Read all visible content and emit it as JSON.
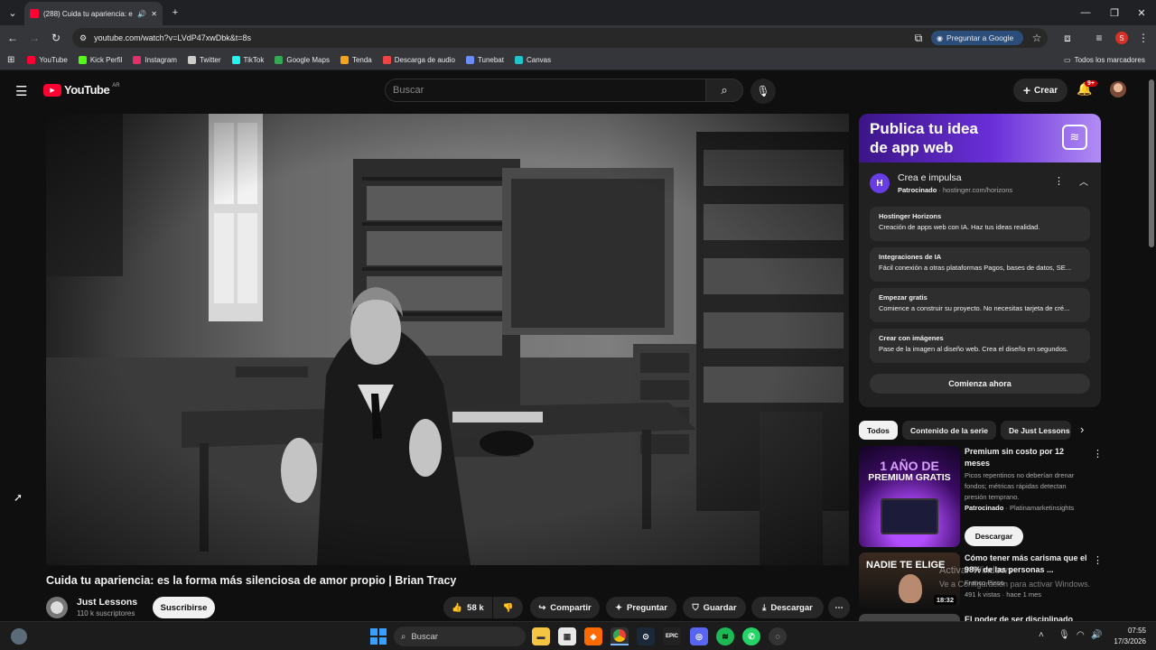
{
  "browser": {
    "tab_title": "(288) Cuida tu apariencia: e",
    "url": "youtube.com/watch?v=LVdP47xwDbk&t=8s",
    "google_button": "Preguntar a Google",
    "profile_initial": "S",
    "bookmarks": [
      {
        "label": "YouTube",
        "color": "#ff0033"
      },
      {
        "label": "Kick Perfil",
        "color": "#53fc18"
      },
      {
        "label": "Instagram",
        "color": "#e1306c"
      },
      {
        "label": "Twitter",
        "color": "#cccccc"
      },
      {
        "label": "TikTok",
        "color": "#25f4ee"
      },
      {
        "label": "Google Maps",
        "color": "#34a853"
      },
      {
        "label": "Tenda",
        "color": "#f7a21b"
      },
      {
        "label": "Descarga de audio",
        "color": "#ef4444"
      },
      {
        "label": "Tunebat",
        "color": "#6c8cff"
      },
      {
        "label": "Canvas",
        "color": "#20c4cb"
      }
    ],
    "all_bookmarks": "Todos los marcadores"
  },
  "youtube": {
    "logo": "YouTube",
    "region": "AR",
    "search_placeholder": "Buscar",
    "create_label": "Crear",
    "notifications": "9+",
    "video": {
      "title": "Cuida tu apariencia: es la forma más silenciosa de amor propio | Brian Tracy",
      "channel": "Just Lessons",
      "subscribers": "110 k suscriptores",
      "subscribe": "Suscribirse",
      "likes": "58 k",
      "share": "Compartir",
      "ask": "Preguntar",
      "save": "Guardar",
      "download": "Descargar"
    },
    "ad": {
      "banner_line1": "Publica tu idea",
      "banner_line2": "de app web",
      "title": "Crea e impulsa",
      "sponsored": "Patrocinado",
      "domain": "hostinger.com/horizons",
      "features": [
        {
          "title": "Hostinger Horizons",
          "desc": "Creación de apps web con IA. Haz tus ideas realidad."
        },
        {
          "title": "Integraciones de IA",
          "desc": "Fácil conexión a otras plataformas Pagos, bases de datos, SE..."
        },
        {
          "title": "Empezar gratis",
          "desc": "Comience a construir su proyecto. No necesitas tarjeta de cré..."
        },
        {
          "title": "Crear con imágenes",
          "desc": "Pase de la imagen al diseño web. Crea el diseño en segundos."
        }
      ],
      "cta": "Comienza ahora"
    },
    "chips": [
      "Todos",
      "Contenido de la serie",
      "De Just Lessons"
    ],
    "recommendations": [
      {
        "thumb_line1": "1 AÑO DE",
        "thumb_line2": "PREMIUM GRATIS",
        "title": "Premium sin costo por 12 meses",
        "desc": "Picos repentinos no deberían drenar fondos; métricas rápidas detectan presión temprano.",
        "sponsored": "Patrocinado",
        "advertiser": "Platinamarketinsights",
        "button": "Descargar"
      },
      {
        "thumb_text": "NADIE TE ELIGE",
        "duration": "18:32",
        "title": "Cómo tener más carisma que el 98% de las personas ...",
        "channel": "Franco Pisso",
        "meta": "491 k vistas · hace 1 mes"
      },
      {
        "title": "El poder de ser disciplinado"
      }
    ],
    "watermark_line1": "Activar Windows",
    "watermark_line2": "Ve a Configuración para activar Windows."
  },
  "taskbar": {
    "search_placeholder": "Buscar",
    "time": "07:55",
    "date": "17/3/2026"
  }
}
